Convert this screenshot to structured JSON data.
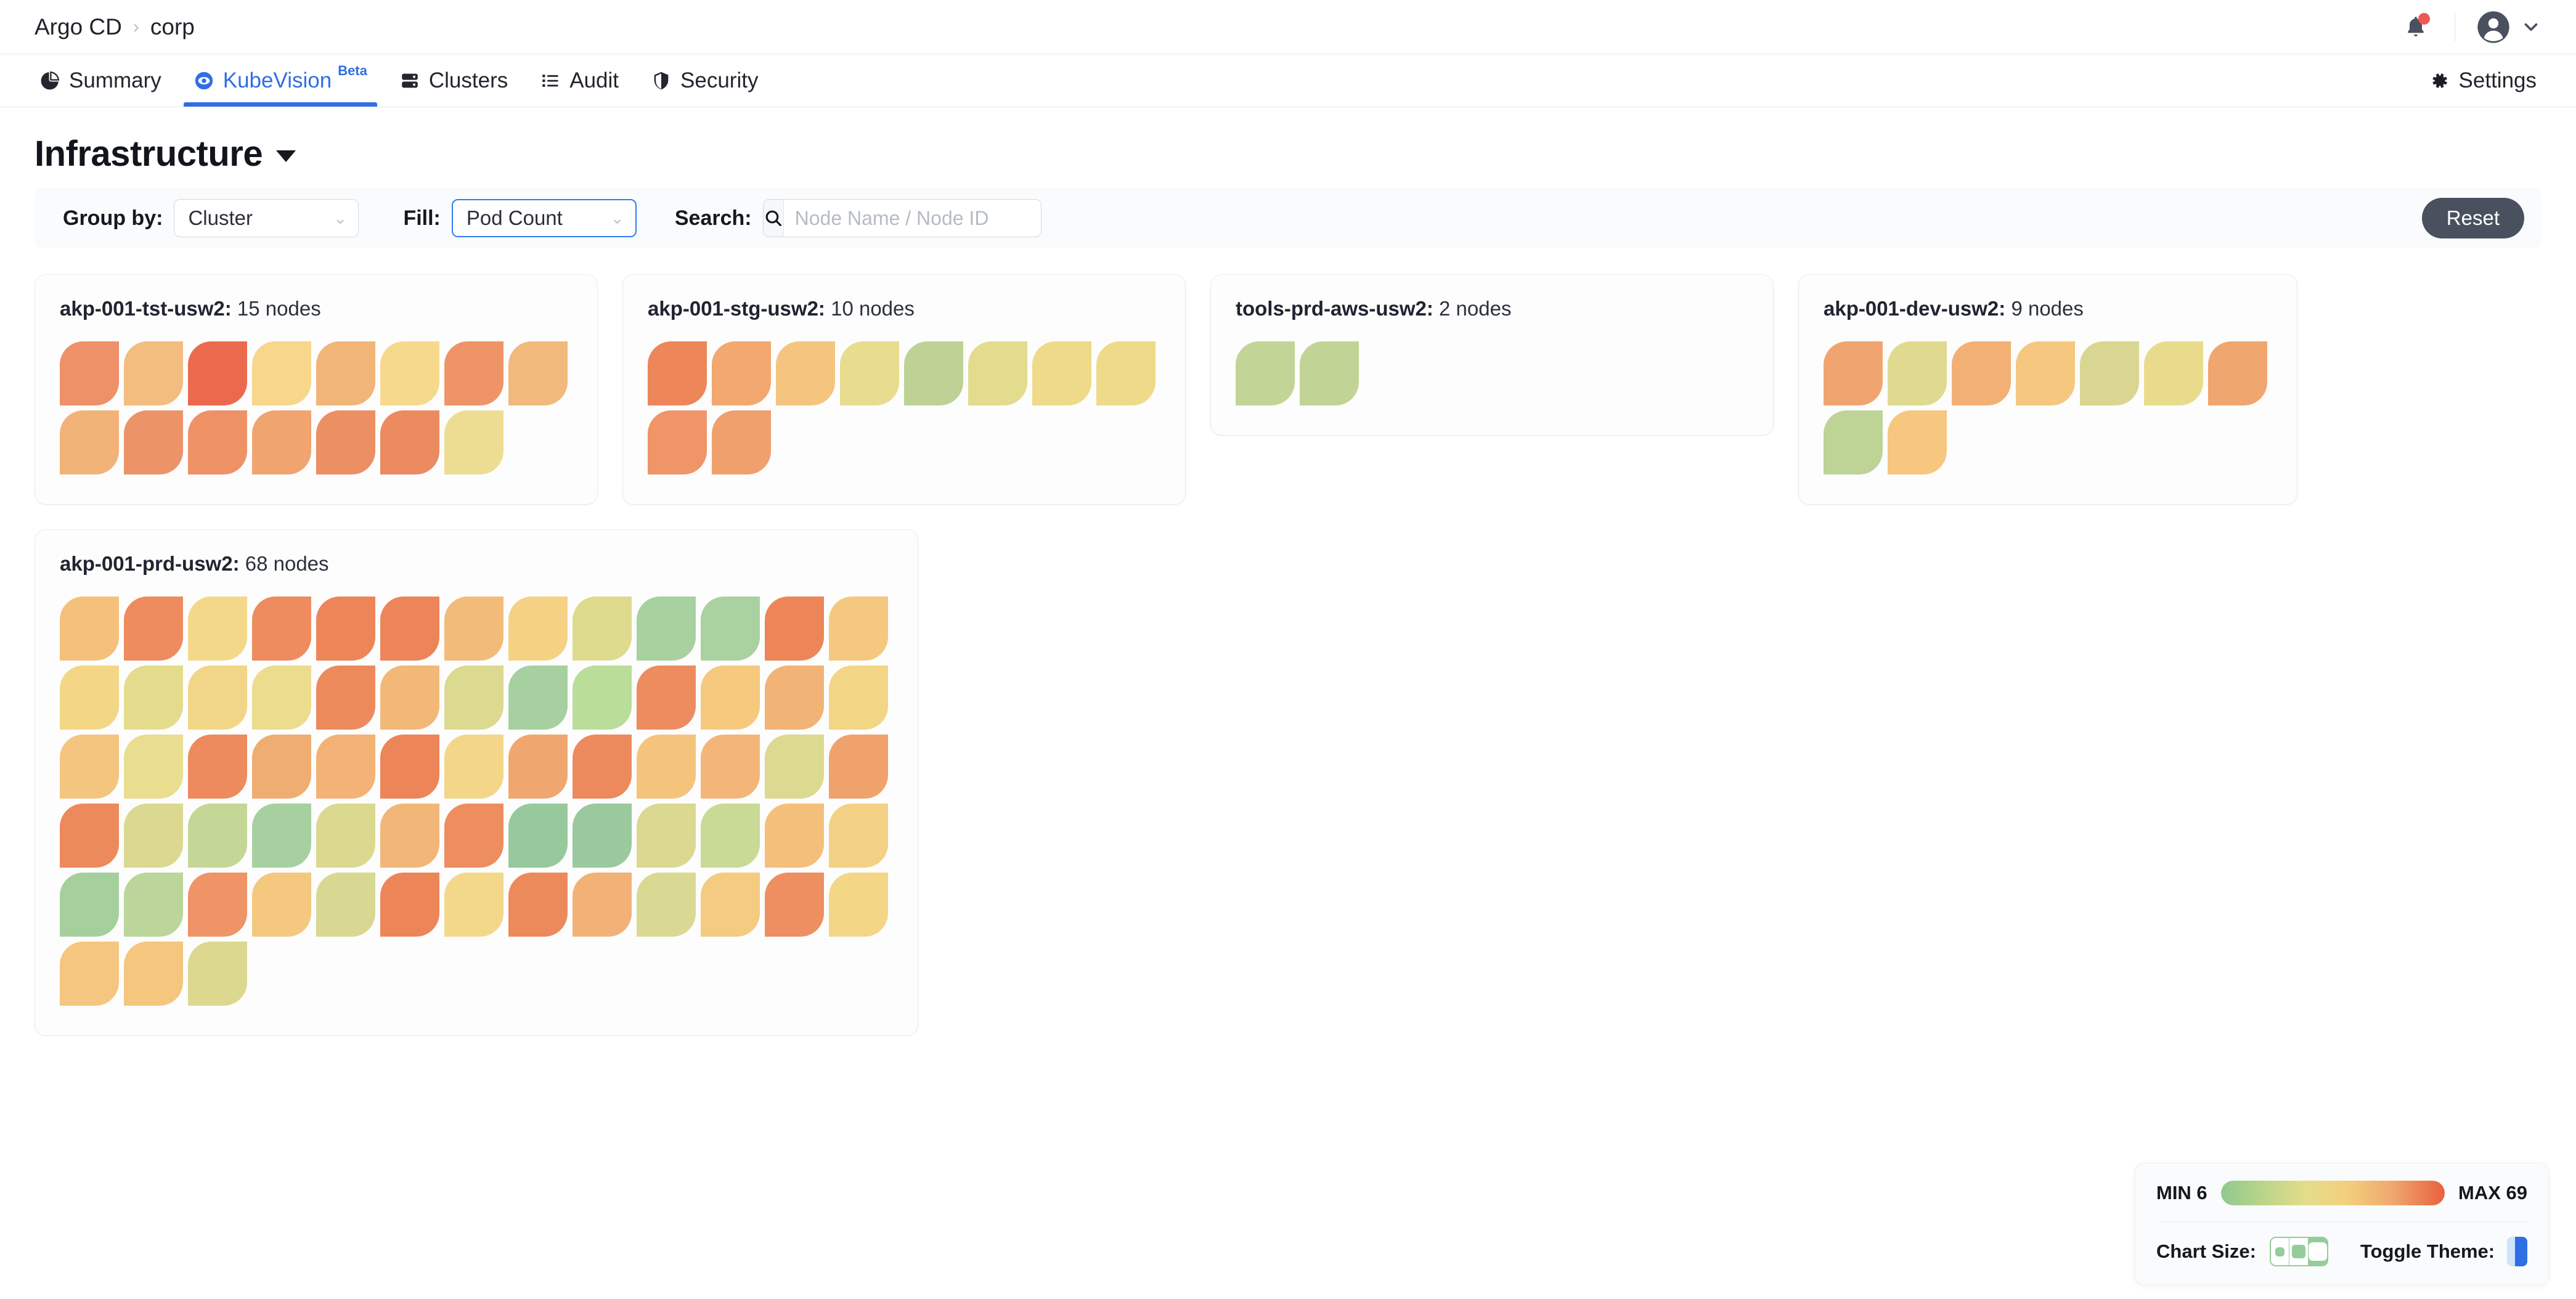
{
  "topbar": {
    "breadcrumb": [
      "Argo CD",
      "corp"
    ],
    "separator": "›",
    "notification_icon": "bell-icon",
    "avatar_icon": "user-avatar-icon",
    "badge_color": "#ee5a52"
  },
  "tabs": [
    {
      "label": "Summary",
      "icon": "pie-chart-icon",
      "active": false
    },
    {
      "label": "KubeVision",
      "icon": "eye-icon",
      "active": true,
      "badge": "Beta"
    },
    {
      "label": "Clusters",
      "icon": "server-icon",
      "active": false
    },
    {
      "label": "Audit",
      "icon": "list-icon",
      "active": false
    },
    {
      "label": "Security",
      "icon": "shield-icon",
      "active": false
    }
  ],
  "settings": {
    "label": "Settings",
    "icon": "gear-icon"
  },
  "page": {
    "title": "Infrastructure"
  },
  "filters": {
    "group_by_label": "Group by:",
    "group_by_value": "Cluster",
    "fill_label": "Fill:",
    "fill_value": "Pod Count",
    "search_label": "Search:",
    "search_value": "",
    "search_placeholder": "Node Name / Node ID",
    "reset_label": "Reset",
    "accent_focus": "#2f7cf6"
  },
  "legend": {
    "min_label": "MIN 6",
    "max_label": "MAX 69",
    "min_value": 6,
    "max_value": 69,
    "chart_size_label": "Chart Size:",
    "chart_size_selected": 3,
    "theme_label": "Toggle Theme:"
  },
  "chart_data": {
    "type": "heatmap",
    "title": "Infrastructure",
    "metric": "Pod Count",
    "grouping": "Cluster",
    "colorscale": [
      "#8fc98f",
      "#b9d48a",
      "#e4dd8b",
      "#f3d07c",
      "#f0a96f",
      "#e8603f"
    ],
    "value_range": [
      6,
      69
    ],
    "clusters": [
      {
        "name": "akp-001-tst-usw2",
        "node_count_label": "15 nodes",
        "node_count": 15,
        "colors": [
          "#ee9068",
          "#f3bd7f",
          "#eb6a4d",
          "#f7d78c",
          "#f1b577",
          "#f7d98d",
          "#ef9466",
          "#f1b97c",
          "#f2b378",
          "#ed9368",
          "#ee9266",
          "#f0a470",
          "#ec8f63",
          "#ec8a60",
          "#eddd92"
        ]
      },
      {
        "name": "akp-001-stg-usw2",
        "node_count_label": "10 nodes",
        "node_count": 10,
        "colors": [
          "#ed8659",
          "#f2a86f",
          "#f5c57f",
          "#e8dc8e",
          "#bdd294",
          "#e3db8e",
          "#eeda88",
          "#efda89",
          "#ef9567",
          "#f0a06c"
        ]
      },
      {
        "name": "tools-prd-aws-usw2",
        "node_count_label": "2 nodes",
        "node_count": 2,
        "colors": [
          "#c3d596",
          "#c2d495"
        ]
      },
      {
        "name": "akp-001-dev-usw2",
        "node_count_label": "9 nodes",
        "node_count": 9,
        "colors": [
          "#f0a570",
          "#dfda8f",
          "#f3b075",
          "#f6c77f",
          "#d9d691",
          "#e8dc8c",
          "#f0a66f",
          "#bed396",
          "#f7c67f"
        ]
      },
      {
        "name": "akp-001-prd-usw2",
        "node_count_label": "68 nodes",
        "node_count": 68,
        "colors": [
          "#f5c07c",
          "#ee8c5f",
          "#f4d88a",
          "#ee8b5f",
          "#ec8659",
          "#ec8559",
          "#f3bb79",
          "#f5d184",
          "#dfdb8e",
          "#a8d1a0",
          "#a9d2a0",
          "#ec8659",
          "#f5c87f",
          "#f3d787",
          "#e4dc8c",
          "#f2d687",
          "#ecdc8d",
          "#ed8a5c",
          "#f2b877",
          "#dcd990",
          "#a7d0a0",
          "#badd9a",
          "#ed8c5f",
          "#f6c97f",
          "#f2b376",
          "#f3d586",
          "#f4c57e",
          "#e9dd8f",
          "#ed8b5e",
          "#f0ad72",
          "#f3b276",
          "#ec8558",
          "#f4d688",
          "#f0a76f",
          "#ed8a5d",
          "#f4c47d",
          "#f3b678",
          "#dcd990",
          "#f0a26c",
          "#ed8a5c",
          "#dbd991",
          "#c4d797",
          "#a7d0a0",
          "#dbd990",
          "#f2b678",
          "#ee8d5f",
          "#98c99c",
          "#99c99c",
          "#dad891",
          "#c9d996",
          "#f4bf7b",
          "#f3d185",
          "#a6cf9e",
          "#bbd59a",
          "#ef9466",
          "#f4c87e",
          "#d8d892",
          "#ec8659",
          "#f3d889",
          "#ed8a5c",
          "#f2b176",
          "#d9d993",
          "#f4cb80",
          "#ee8f62",
          "#f4d687",
          "#f5c67f",
          "#f4c67e",
          "#dcd88f"
        ]
      }
    ]
  }
}
